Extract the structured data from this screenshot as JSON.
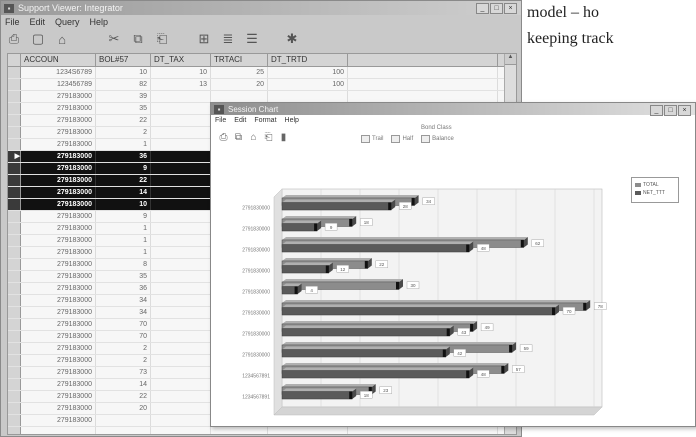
{
  "page_text": {
    "line1": "model – ho",
    "line2": "keeping track"
  },
  "back_window": {
    "title": "Support Viewer: Integrator",
    "menu": [
      "File",
      "Edit",
      "Query",
      "Help"
    ],
    "window_buttons": [
      "_",
      "□",
      "×"
    ],
    "toolbar_icons": [
      "print-icon",
      "new-icon",
      "save-icon",
      "cut-icon",
      "copy-icon",
      "paste-icon",
      "layout-icon",
      "sort-icon",
      "filter-icon",
      "settings-icon"
    ],
    "columns": [
      "ACCOUN",
      "BOL#57",
      "DT_TAX",
      "TRTACI",
      "DT_TRTD"
    ],
    "rows": [
      {
        "acc": "1234S6789",
        "bol": "10",
        "dt": "10",
        "tr": "25",
        "td": "100",
        "sel": false
      },
      {
        "acc": "123456789",
        "bol": "82",
        "dt": "13",
        "tr": "20",
        "td": "100",
        "sel": false
      },
      {
        "acc": "279183000",
        "bol": "39",
        "dt": "",
        "tr": "",
        "td": "",
        "sel": false
      },
      {
        "acc": "279183000",
        "bol": "35",
        "dt": "",
        "tr": "",
        "td": "",
        "sel": false
      },
      {
        "acc": "279183000",
        "bol": "22",
        "dt": "",
        "tr": "",
        "td": "",
        "sel": false
      },
      {
        "acc": "279183000",
        "bol": "2",
        "dt": "",
        "tr": "",
        "td": "",
        "sel": false
      },
      {
        "acc": "279183000",
        "bol": "1",
        "dt": "",
        "tr": "",
        "td": "",
        "sel": false
      },
      {
        "acc": "279183000",
        "bol": "36",
        "dt": "",
        "tr": "",
        "td": "",
        "sel": true
      },
      {
        "acc": "279183000",
        "bol": "9",
        "dt": "",
        "tr": "",
        "td": "",
        "sel": true
      },
      {
        "acc": "279183000",
        "bol": "22",
        "dt": "",
        "tr": "",
        "td": "",
        "sel": true
      },
      {
        "acc": "279183000",
        "bol": "14",
        "dt": "",
        "tr": "",
        "td": "",
        "sel": true
      },
      {
        "acc": "279183000",
        "bol": "10",
        "dt": "",
        "tr": "",
        "td": "",
        "sel": true
      },
      {
        "acc": "279183000",
        "bol": "9",
        "dt": "",
        "tr": "",
        "td": "",
        "sel": false
      },
      {
        "acc": "279183000",
        "bol": "1",
        "dt": "",
        "tr": "",
        "td": "",
        "sel": false
      },
      {
        "acc": "279183000",
        "bol": "1",
        "dt": "",
        "tr": "",
        "td": "",
        "sel": false
      },
      {
        "acc": "279183000",
        "bol": "1",
        "dt": "",
        "tr": "",
        "td": "",
        "sel": false
      },
      {
        "acc": "279183000",
        "bol": "8",
        "dt": "",
        "tr": "",
        "td": "",
        "sel": false
      },
      {
        "acc": "279183000",
        "bol": "35",
        "dt": "",
        "tr": "",
        "td": "",
        "sel": false
      },
      {
        "acc": "279183000",
        "bol": "36",
        "dt": "",
        "tr": "",
        "td": "",
        "sel": false
      },
      {
        "acc": "279183000",
        "bol": "34",
        "dt": "",
        "tr": "",
        "td": "",
        "sel": false
      },
      {
        "acc": "279183000",
        "bol": "34",
        "dt": "",
        "tr": "",
        "td": "",
        "sel": false
      },
      {
        "acc": "279183000",
        "bol": "70",
        "dt": "",
        "tr": "",
        "td": "",
        "sel": false
      },
      {
        "acc": "279183000",
        "bol": "70",
        "dt": "",
        "tr": "",
        "td": "",
        "sel": false
      },
      {
        "acc": "279183000",
        "bol": "2",
        "dt": "",
        "tr": "",
        "td": "",
        "sel": false
      },
      {
        "acc": "279183000",
        "bol": "2",
        "dt": "",
        "tr": "",
        "td": "",
        "sel": false
      },
      {
        "acc": "279183000",
        "bol": "73",
        "dt": "",
        "tr": "",
        "td": "",
        "sel": false
      },
      {
        "acc": "279183000",
        "bol": "14",
        "dt": "",
        "tr": "",
        "td": "",
        "sel": false
      },
      {
        "acc": "279183000",
        "bol": "22",
        "dt": "",
        "tr": "",
        "td": "",
        "sel": false
      },
      {
        "acc": "279183000",
        "bol": "20",
        "dt": "",
        "tr": "",
        "td": "",
        "sel": false
      },
      {
        "acc": "279183000",
        "bol": "",
        "dt": "",
        "tr": "",
        "td": "",
        "sel": false
      },
      {
        "acc": "",
        "bol": "",
        "dt": "",
        "tr": "",
        "td": "",
        "sel": false
      },
      {
        "acc": "",
        "bol": "",
        "dt": "",
        "tr": "",
        "td": "",
        "sel": false
      }
    ]
  },
  "front_window": {
    "title": "Session Chart",
    "menu": [
      "File",
      "Edit",
      "Format",
      "Help"
    ],
    "window_buttons": [
      "_",
      "□",
      "×"
    ],
    "toolbar_icons": [
      "print-icon",
      "copy-icon",
      "save-icon",
      "export-icon",
      "settings-icon"
    ],
    "bar_type_label": "Bond Class",
    "bar_type_options": [
      "Trail",
      "Half",
      "Balance"
    ],
    "legend_items": [
      "TOTAL",
      "NET_TTT"
    ],
    "small_legend": [
      "------",
      "------"
    ],
    "accent_colors": {
      "bar_a": "#8c8c8c",
      "bar_b": "#5a5a5a",
      "selected_row": "#111111",
      "titlebar": "#9a9a9a"
    }
  },
  "chart_data": {
    "type": "bar",
    "orientation": "horizontal",
    "title": "",
    "xlabel": "Total",
    "ylabel": "",
    "xlim": [
      0,
      80
    ],
    "x_ticks": [
      0,
      10,
      20,
      30,
      40,
      50,
      60,
      70,
      80
    ],
    "categories": [
      "2791830000",
      "2791830000",
      "2791830000",
      "2791830000",
      "2791830000",
      "2791830000",
      "2791830000",
      "2791830000",
      "1234567891",
      "1234567891"
    ],
    "series": [
      {
        "values": [
          34,
          18,
          62,
          22,
          30,
          78,
          49,
          59,
          57,
          23
        ]
      },
      {
        "values": [
          28,
          9,
          48,
          12,
          4,
          70,
          43,
          42,
          48,
          18
        ]
      }
    ]
  }
}
